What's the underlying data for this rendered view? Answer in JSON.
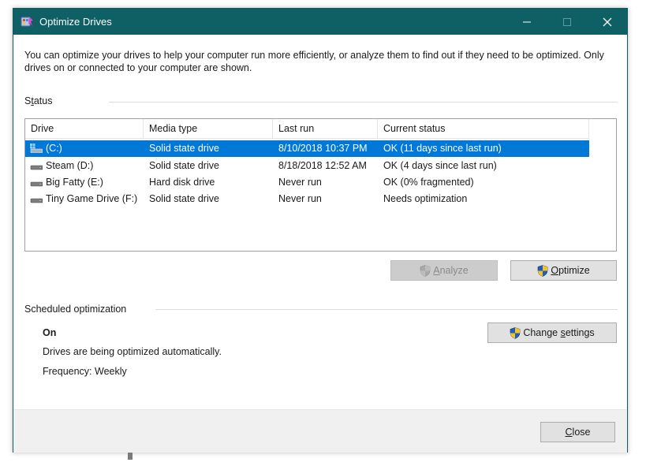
{
  "window": {
    "title": "Optimize Drives",
    "minimize_glyph": "—",
    "maximize_glyph": "☐",
    "close_glyph": "✕"
  },
  "intro_text": "You can optimize your drives to help your computer run more efficiently, or analyze them to find out if they need to be optimized. Only drives on or connected to your computer are shown.",
  "status_section": {
    "label_prefix": "S",
    "label_accel": "t",
    "label_suffix": "atus",
    "columns": [
      "Drive",
      "Media type",
      "Last run",
      "Current status"
    ],
    "rows": [
      {
        "drive": "(C:)",
        "media": "Solid state drive",
        "last_run": "8/10/2018 10:37 PM",
        "status": "OK (11 days since last run)",
        "selected": true,
        "icon": "windows-drive-icon"
      },
      {
        "drive": "Steam (D:)",
        "media": "Solid state drive",
        "last_run": "8/18/2018 12:52 AM",
        "status": "OK (4 days since last run)",
        "selected": false,
        "icon": "drive-icon"
      },
      {
        "drive": "Big Fatty (E:)",
        "media": "Hard disk drive",
        "last_run": "Never run",
        "status": "OK (0% fragmented)",
        "selected": false,
        "icon": "drive-icon"
      },
      {
        "drive": "Tiny Game Drive (F:)",
        "media": "Solid state drive",
        "last_run": "Never run",
        "status": "Needs optimization",
        "selected": false,
        "icon": "drive-icon"
      }
    ]
  },
  "buttons": {
    "analyze_accel": "A",
    "analyze_rest": "nalyze",
    "optimize_accel": "O",
    "optimize_rest": "ptimize",
    "change_prefix": "Change ",
    "change_accel": "s",
    "change_rest": "ettings",
    "close_accel": "C",
    "close_rest": "lose"
  },
  "scheduled": {
    "label": "Scheduled optimization",
    "state": "On",
    "description": "Drives are being optimized automatically.",
    "frequency": "Frequency: Weekly"
  },
  "colors": {
    "titlebar": "#0e6064",
    "selection": "#0078d7",
    "shield_blue": "#1f5fb4",
    "shield_yellow": "#f2c22e"
  }
}
